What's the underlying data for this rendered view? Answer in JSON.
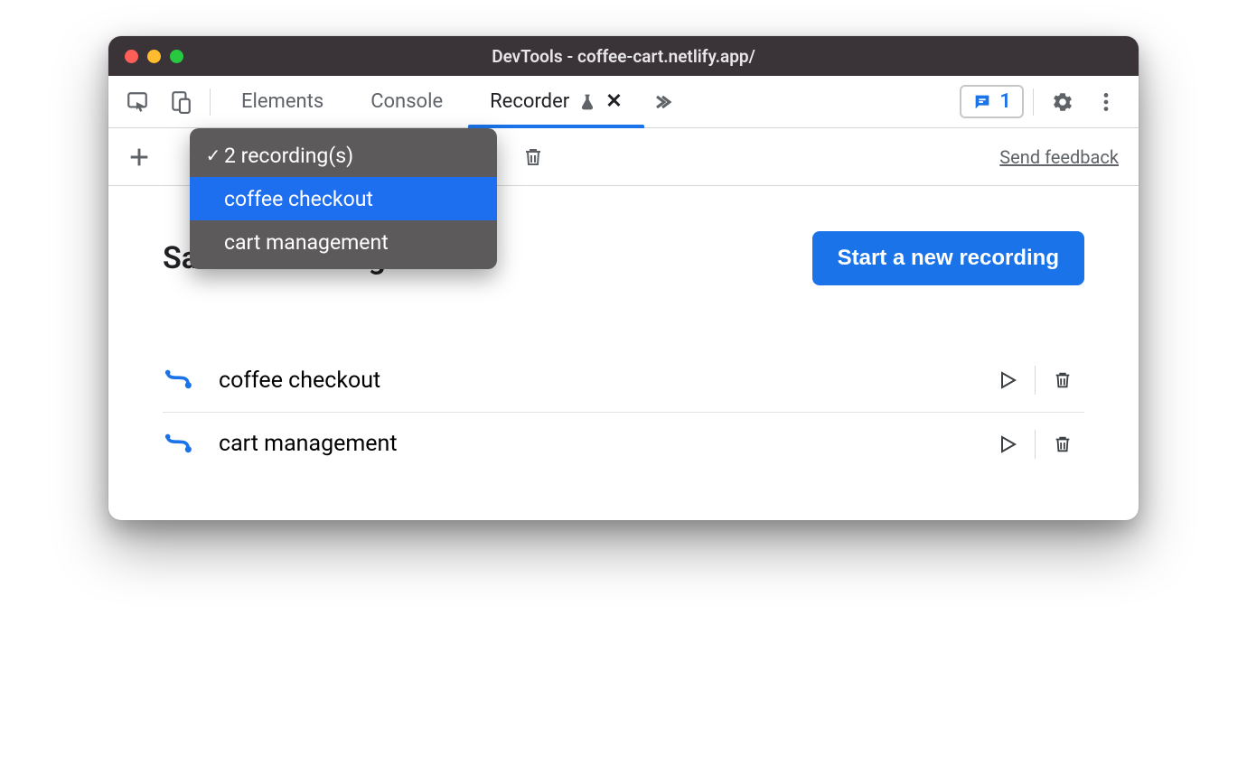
{
  "window": {
    "title": "DevTools - coffee-cart.netlify.app/"
  },
  "tabs": {
    "elements": "Elements",
    "console": "Console",
    "recorder": "Recorder"
  },
  "issues": {
    "count": "1"
  },
  "toolbar": {
    "send_feedback": "Send feedback"
  },
  "dropdown": {
    "summary": "2 recording(s)",
    "items": [
      "coffee checkout",
      "cart management"
    ]
  },
  "content": {
    "heading": "Saved recordings",
    "start_button": "Start a new recording"
  },
  "recordings": [
    {
      "name": "coffee checkout"
    },
    {
      "name": "cart management"
    }
  ]
}
